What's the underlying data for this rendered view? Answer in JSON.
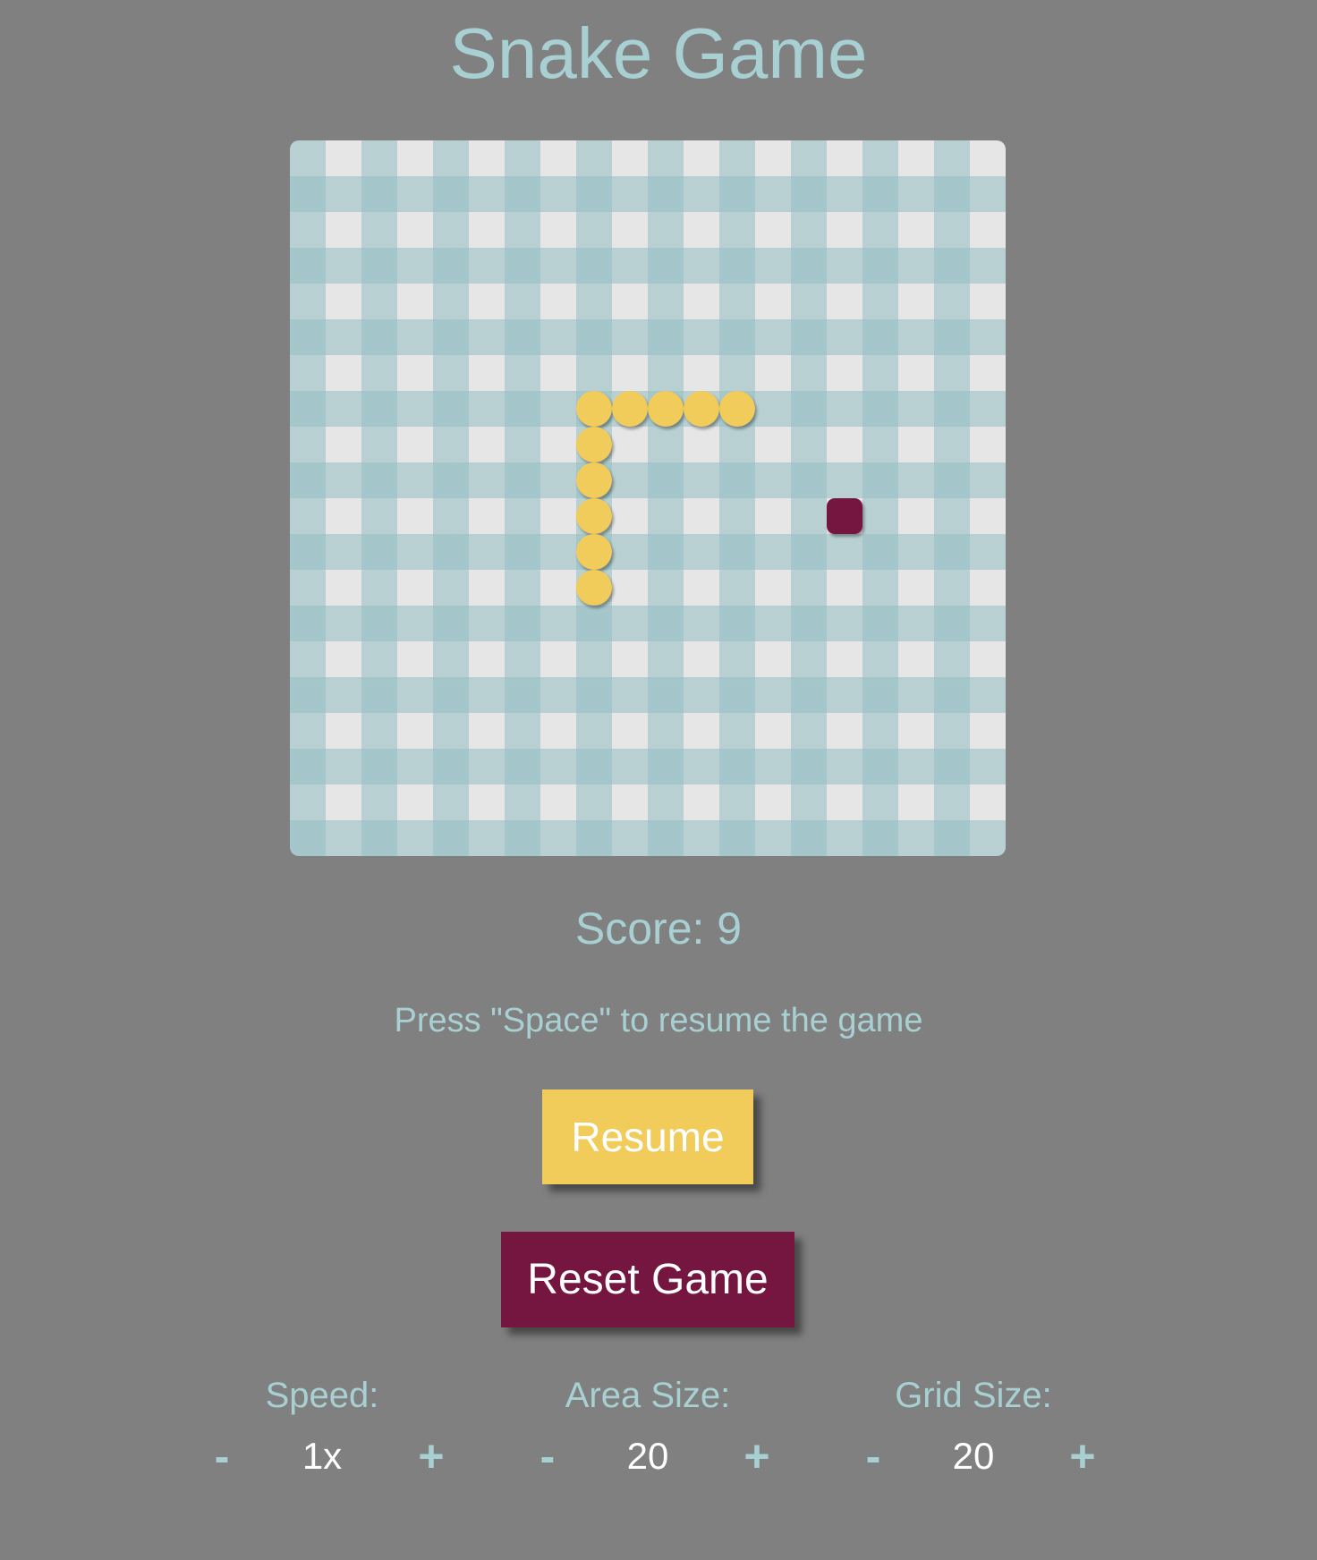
{
  "title": "Snake Game",
  "board": {
    "grid_cells": 20,
    "snake": [
      {
        "col": 8,
        "row": 7
      },
      {
        "col": 9,
        "row": 7
      },
      {
        "col": 10,
        "row": 7
      },
      {
        "col": 11,
        "row": 7
      },
      {
        "col": 12,
        "row": 7
      },
      {
        "col": 8,
        "row": 8
      },
      {
        "col": 8,
        "row": 9
      },
      {
        "col": 8,
        "row": 10
      },
      {
        "col": 8,
        "row": 11
      },
      {
        "col": 8,
        "row": 12
      }
    ],
    "food": {
      "col": 15,
      "row": 10
    },
    "colors": {
      "snake": "#f2cc5b",
      "food": "#74163f",
      "checker": "#94bfc4",
      "board_light": "#e6e6e6"
    }
  },
  "score_text": "Score: 9",
  "hint_text": "Press \"Space\" to resume the game",
  "buttons": {
    "resume": "Resume",
    "reset": "Reset Game"
  },
  "controls": {
    "speed": {
      "label": "Speed:",
      "minus": "-",
      "value": "1x",
      "plus": "+"
    },
    "area": {
      "label": "Area Size:",
      "minus": "-",
      "value": "20",
      "plus": "+"
    },
    "grid": {
      "label": "Grid Size:",
      "minus": "-",
      "value": "20",
      "plus": "+"
    }
  },
  "theme": {
    "background": "#808080",
    "accent_text": "#a8d0d3",
    "resume_color": "#f2cc5b",
    "reset_color": "#74163f"
  }
}
